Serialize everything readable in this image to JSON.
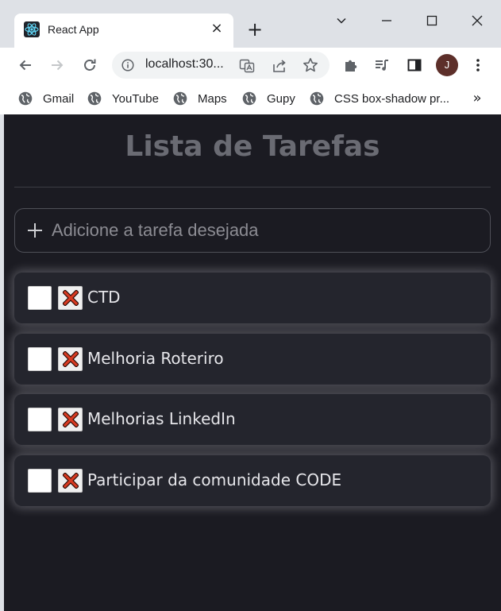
{
  "tab": {
    "title": "React App",
    "close": "×",
    "new_tab": "+"
  },
  "toolbar": {
    "url": "localhost:30...",
    "avatar_initial": "J"
  },
  "bookmarks": {
    "items": [
      {
        "label": "Gmail",
        "icon": "globe-icon"
      },
      {
        "label": "YouTube",
        "icon": "globe-icon"
      },
      {
        "label": "Maps",
        "icon": "globe-icon"
      },
      {
        "label": "Gupy",
        "icon": "globe-icon"
      },
      {
        "label": "CSS box-shadow pr...",
        "icon": "globe-icon"
      }
    ],
    "overflow": "»"
  },
  "app": {
    "title": "Lista de Tarefas",
    "input_placeholder": "Adicione a tarefa desejada",
    "input_value": "",
    "tasks": [
      {
        "text": "CTD",
        "done": false
      },
      {
        "text": "Melhoria Roteriro",
        "done": false
      },
      {
        "text": "Melhorias LinkedIn",
        "done": false
      },
      {
        "text": "Participar da comunidade CODE",
        "done": false
      }
    ]
  },
  "colors": {
    "app_background": "#1b1b22",
    "task_background": "#24252d",
    "title_color": "#6a6b73",
    "delete_x": "#d93b22",
    "chrome_frame": "#dee1e6",
    "avatar": "#5d2f2a"
  }
}
